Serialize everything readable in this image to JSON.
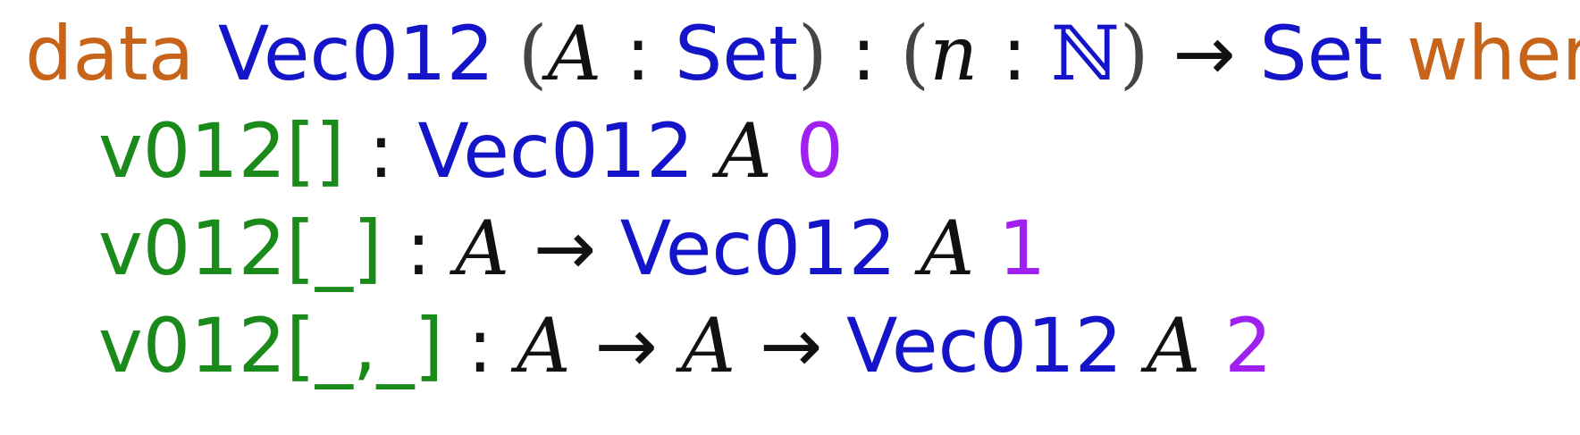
{
  "colors": {
    "keyword": "#c8641a",
    "type": "#1414c8",
    "constructor": "#1a8a1a",
    "number": "#a020f0",
    "plain": "#111111"
  },
  "decl": {
    "kw_data": "data",
    "type_name": "Vec012",
    "open_paren_1": "(",
    "var_A": "A",
    "colon_1": ":",
    "set_1": "Set",
    "close_paren_1": ")",
    "colon_2": ":",
    "open_paren_2": "(",
    "var_n": "n",
    "colon_3": ":",
    "nat": "ℕ",
    "close_paren_2": ")",
    "arrow": "→",
    "set_2": "Set",
    "kw_where": "where"
  },
  "constructors": [
    {
      "name": "v012[]",
      "colon": ":",
      "type_name": "Vec012",
      "var": "A",
      "index": "0"
    },
    {
      "name": "v012[_]",
      "colon": ":",
      "arg_1": "A",
      "arrow_1": "→",
      "type_name": "Vec012",
      "var": "A",
      "index": "1"
    },
    {
      "name": "v012[_,_]",
      "colon": ":",
      "arg_1": "A",
      "arrow_1": "→",
      "arg_2": "A",
      "arrow_2": "→",
      "type_name": "Vec012",
      "var": "A",
      "index": "2"
    }
  ]
}
